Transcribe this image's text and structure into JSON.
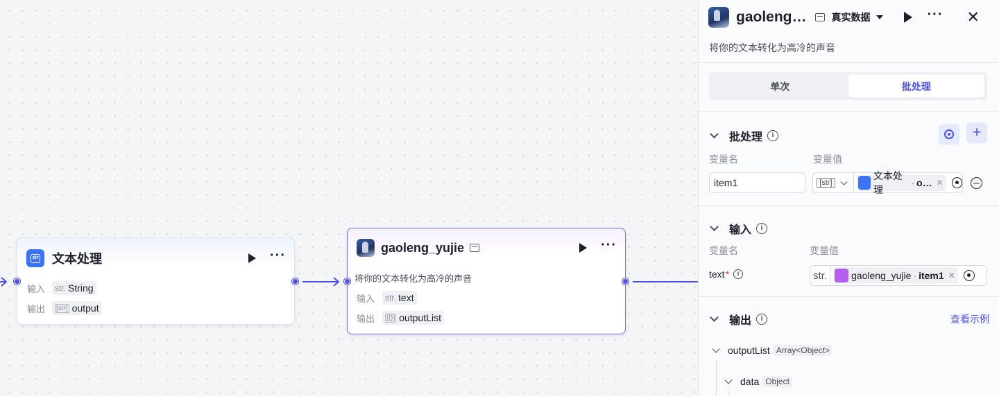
{
  "canvas": {
    "nodes": [
      {
        "title": "文本处理",
        "icon": "text-process-icon",
        "input_label": "输入",
        "input_type": "str.",
        "input_value": "String",
        "output_label": "输出",
        "output_type": "[str]",
        "output_value": "output"
      },
      {
        "title": "gaoleng_yujie",
        "icon": "avatar-icon",
        "description": "将你的文本转化为高冷的声音",
        "input_label": "输入",
        "input_type": "str.",
        "input_value": "text",
        "output_label": "输出",
        "output_type": "[{}]",
        "output_value": "outputList"
      }
    ]
  },
  "panel": {
    "title": "gaoleng…",
    "data_mode": "真实数据",
    "description": "将你的文本转化为高冷的声音",
    "tabs": [
      "单次",
      "批处理"
    ],
    "active_tab": "批处理",
    "batch": {
      "title": "批处理",
      "col_name": "变量名",
      "col_value": "变量值",
      "name_value": "item1",
      "type": "[str]",
      "ref_node": "文本处理",
      "ref_field": "o…"
    },
    "input": {
      "title": "输入",
      "col_name": "变量名",
      "col_value": "变量值",
      "var_name": "text",
      "required_mark": "*",
      "type": "str.",
      "ref_node": "gaoleng_yujie",
      "ref_field": "item1"
    },
    "output": {
      "title": "输出",
      "example_link": "查看示例",
      "tree": [
        {
          "name": "outputList",
          "type": "Array<Object>"
        },
        {
          "name": "data",
          "type": "Object"
        }
      ]
    },
    "accent_color": "#4d53e8",
    "edge_color": "#4c4ee6"
  }
}
